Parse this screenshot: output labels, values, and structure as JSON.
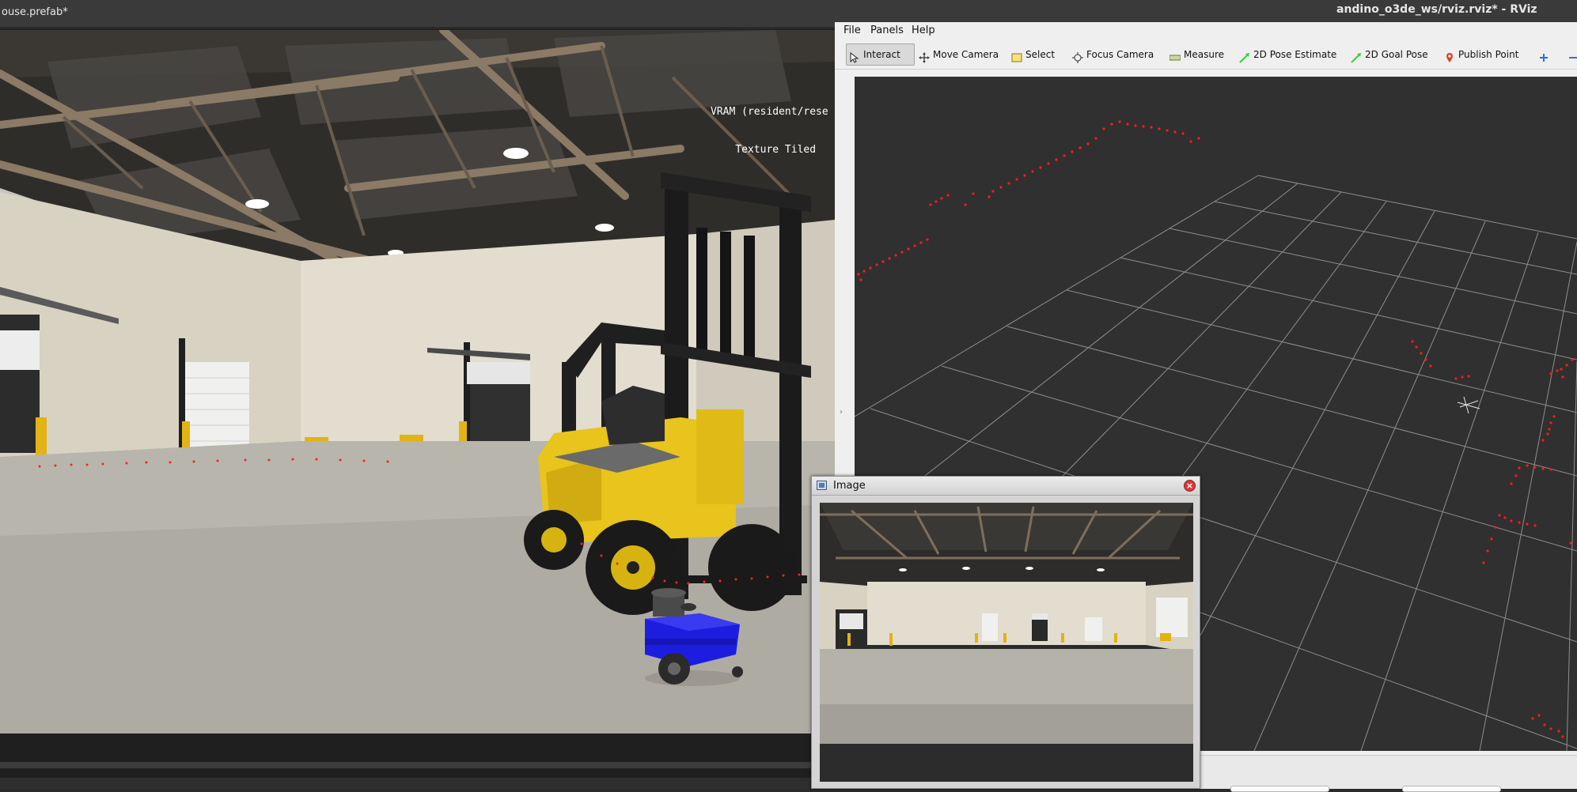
{
  "o3de": {
    "window_title": "ouse.prefab*",
    "vram_line1": "VRAM (resident/rese",
    "vram_line2": "    Texture Tiled"
  },
  "rviz": {
    "window_title": "andino_o3de_ws/rviz.rviz* - RViz",
    "menu": [
      "File",
      "Panels",
      "Help"
    ],
    "tools": [
      {
        "label": "Interact",
        "icon": "cursor-icon",
        "active": true
      },
      {
        "label": "Move Camera",
        "icon": "move-camera-icon",
        "active": false
      },
      {
        "label": "Select",
        "icon": "select-icon",
        "active": false
      },
      {
        "label": "Focus Camera",
        "icon": "focus-camera-icon",
        "active": false
      },
      {
        "label": "Measure",
        "icon": "ruler-icon",
        "active": false
      },
      {
        "label": "2D Pose Estimate",
        "icon": "pose-arrow-icon",
        "active": false
      },
      {
        "label": "2D Goal Pose",
        "icon": "goal-arrow-icon",
        "active": false
      },
      {
        "label": "Publish Point",
        "icon": "map-pin-icon",
        "active": false
      }
    ],
    "colors": {
      "laser_points": "#ff1a1a",
      "grid": "#8e8e8e",
      "background": "#303030",
      "pose_arrow": "#3ccf3c",
      "pin": "#d04a2a",
      "plus": "#2f6fe0"
    }
  },
  "image_window": {
    "title": "Image",
    "close_glyph": "×"
  }
}
